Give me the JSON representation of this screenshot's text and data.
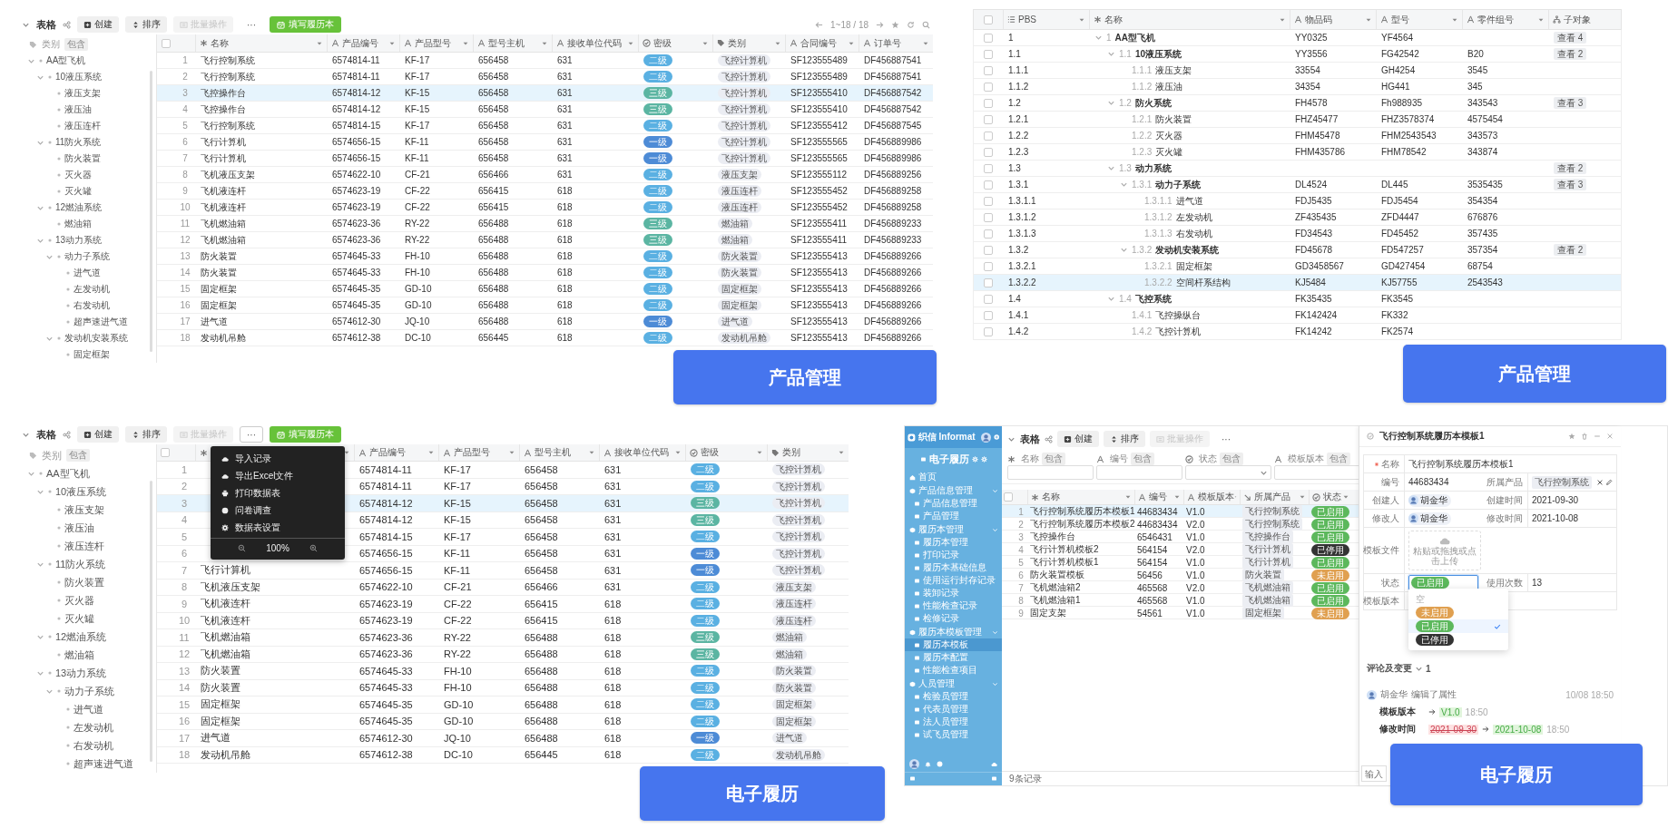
{
  "grid_view": {
    "toolbar": {
      "title": "表格",
      "buttons": [
        {
          "label": "创建",
          "kind": "create",
          "disabled": false
        },
        {
          "label": "排序",
          "kind": "sort",
          "disabled": false
        },
        {
          "label": "批量操作",
          "kind": "batch",
          "disabled": true
        }
      ],
      "more": {
        "label": "···",
        "active": false
      },
      "primary": "填写履历本"
    },
    "pager": "1~18 / 18",
    "tree": {
      "filter_label": "类别",
      "filter_op": "包含",
      "items": [
        {
          "label": "AA型飞机",
          "expanded": true,
          "children": [
            {
              "label": "10液压系统",
              "expanded": true,
              "children": [
                {
                  "label": "液压支架"
                },
                {
                  "label": "液压油"
                },
                {
                  "label": "液压连杆"
                }
              ]
            },
            {
              "label": "11防火系统",
              "expanded": true,
              "children": [
                {
                  "label": "防火装置"
                },
                {
                  "label": "灭火器"
                },
                {
                  "label": "灭火罐"
                }
              ]
            },
            {
              "label": "12燃油系统",
              "expanded": true,
              "children": [
                {
                  "label": "燃油箱"
                }
              ]
            },
            {
              "label": "13动力系统",
              "expanded": true,
              "children": [
                {
                  "label": "动力子系统",
                  "expanded": true,
                  "children": [
                    {
                      "label": "进气道"
                    },
                    {
                      "label": "左发动机"
                    },
                    {
                      "label": "右发动机"
                    },
                    {
                      "label": "超声速进气道"
                    }
                  ]
                },
                {
                  "label": "发动机安装系统",
                  "expanded": true,
                  "children": [
                    {
                      "label": "固定框架"
                    }
                  ]
                }
              ]
            }
          ]
        }
      ]
    },
    "all_checked": false,
    "columns": [
      {
        "label": "名称",
        "kind": "name"
      },
      {
        "label": "产品编号",
        "kind": "text"
      },
      {
        "label": "产品型号",
        "kind": "text"
      },
      {
        "label": "型号主机",
        "kind": "text"
      },
      {
        "label": "接收单位代码",
        "kind": "text"
      },
      {
        "label": "密级",
        "kind": "select"
      },
      {
        "label": "类别",
        "kind": "tag"
      },
      {
        "label": "合同编号",
        "kind": "text"
      },
      {
        "label": "订单号",
        "kind": "text"
      }
    ],
    "rows": [
      {
        "n": "1",
        "name": "飞行控制系统",
        "product_no": "6574814-11",
        "model": "KF-17",
        "host": "656458",
        "unit": "631",
        "secrecy": {
          "text": "二级",
          "color": "#5ab0e2"
        },
        "category": "飞控计算机",
        "contract": "SF123555489",
        "order": "DF456887541",
        "selected": false
      },
      {
        "n": "2",
        "name": "飞行控制系统",
        "product_no": "6574814-11",
        "model": "KF-17",
        "host": "656458",
        "unit": "631",
        "secrecy": {
          "text": "二级",
          "color": "#5ab0e2"
        },
        "category": "飞控计算机",
        "contract": "SF123555489",
        "order": "DF456887541",
        "selected": false
      },
      {
        "n": "3",
        "name": "飞控操作台",
        "product_no": "6574814-12",
        "model": "KF-15",
        "host": "656458",
        "unit": "631",
        "secrecy": {
          "text": "三级",
          "color": "#5bb5a2"
        },
        "category": "飞控计算机",
        "contract": "SF123555410",
        "order": "DF456887542",
        "selected": true
      },
      {
        "n": "4",
        "name": "飞控操作台",
        "product_no": "6574814-12",
        "model": "KF-15",
        "host": "656458",
        "unit": "631",
        "secrecy": {
          "text": "三级",
          "color": "#5bb5a2"
        },
        "category": "飞控计算机",
        "contract": "SF123555410",
        "order": "DF456887542",
        "selected": false
      },
      {
        "n": "5",
        "name": "飞行控制系统",
        "product_no": "6574814-15",
        "model": "KF-17",
        "host": "656458",
        "unit": "631",
        "secrecy": {
          "text": "二级",
          "color": "#5ab0e2"
        },
        "category": "飞控计算机",
        "contract": "SF123555412",
        "order": "DF456887545",
        "selected": false
      },
      {
        "n": "6",
        "name": "飞行计算机",
        "product_no": "6574656-15",
        "model": "KF-11",
        "host": "656458",
        "unit": "631",
        "secrecy": {
          "text": "一级",
          "color": "#4d8bd6"
        },
        "category": "飞控计算机",
        "contract": "SF123555565",
        "order": "DF456889986",
        "selected": false
      },
      {
        "n": "7",
        "name": "飞行计算机",
        "product_no": "6574656-15",
        "model": "KF-11",
        "host": "656458",
        "unit": "631",
        "secrecy": {
          "text": "一级",
          "color": "#4d8bd6"
        },
        "category": "飞控计算机",
        "contract": "SF123555565",
        "order": "DF456889986",
        "selected": false
      },
      {
        "n": "8",
        "name": "飞机液压支架",
        "product_no": "6574622-10",
        "model": "CF-21",
        "host": "656466",
        "unit": "631",
        "secrecy": {
          "text": "二级",
          "color": "#5ab0e2"
        },
        "category": "液压支架",
        "contract": "SF123555112",
        "order": "DF456889256",
        "selected": false
      },
      {
        "n": "9",
        "name": "飞机液连杆",
        "product_no": "6574623-19",
        "model": "CF-22",
        "host": "656415",
        "unit": "618",
        "secrecy": {
          "text": "二级",
          "color": "#5ab0e2"
        },
        "category": "液压连杆",
        "contract": "SF123555452",
        "order": "DF456889258",
        "selected": false
      },
      {
        "n": "10",
        "name": "飞机液连杆",
        "product_no": "6574623-19",
        "model": "CF-22",
        "host": "656415",
        "unit": "618",
        "secrecy": {
          "text": "二级",
          "color": "#5ab0e2"
        },
        "category": "液压连杆",
        "contract": "SF123555452",
        "order": "DF456889258",
        "selected": false
      },
      {
        "n": "11",
        "name": "飞机燃油箱",
        "product_no": "6574623-36",
        "model": "RY-22",
        "host": "656488",
        "unit": "618",
        "secrecy": {
          "text": "三级",
          "color": "#5bb5a2"
        },
        "category": "燃油箱",
        "contract": "SF123555411",
        "order": "DF456889233",
        "selected": false
      },
      {
        "n": "12",
        "name": "飞机燃油箱",
        "product_no": "6574623-36",
        "model": "RY-22",
        "host": "656488",
        "unit": "618",
        "secrecy": {
          "text": "三级",
          "color": "#5bb5a2"
        },
        "category": "燃油箱",
        "contract": "SF123555411",
        "order": "DF456889233",
        "selected": false
      },
      {
        "n": "13",
        "name": "防火装置",
        "product_no": "6574645-33",
        "model": "FH-10",
        "host": "656488",
        "unit": "618",
        "secrecy": {
          "text": "二级",
          "color": "#5ab0e2"
        },
        "category": "防火装置",
        "contract": "SF123555413",
        "order": "DF456889266",
        "selected": false
      },
      {
        "n": "14",
        "name": "防火装置",
        "product_no": "6574645-33",
        "model": "FH-10",
        "host": "656488",
        "unit": "618",
        "secrecy": {
          "text": "二级",
          "color": "#5ab0e2"
        },
        "category": "防火装置",
        "contract": "SF123555413",
        "order": "DF456889266",
        "selected": false
      },
      {
        "n": "15",
        "name": "固定框架",
        "product_no": "6574645-35",
        "model": "GD-10",
        "host": "656488",
        "unit": "618",
        "secrecy": {
          "text": "二级",
          "color": "#5ab0e2"
        },
        "category": "固定框架",
        "contract": "SF123555413",
        "order": "DF456889266",
        "selected": false
      },
      {
        "n": "16",
        "name": "固定框架",
        "product_no": "6574645-35",
        "model": "GD-10",
        "host": "656488",
        "unit": "618",
        "secrecy": {
          "text": "二级",
          "color": "#5ab0e2"
        },
        "category": "固定框架",
        "contract": "SF123555413",
        "order": "DF456889266",
        "selected": false
      },
      {
        "n": "17",
        "name": "进气道",
        "product_no": "6574612-30",
        "model": "JQ-10",
        "host": "656488",
        "unit": "618",
        "secrecy": {
          "text": "一级",
          "color": "#4d8bd6"
        },
        "category": "进气道",
        "contract": "SF123555413",
        "order": "DF456889266",
        "selected": false
      },
      {
        "n": "18",
        "name": "发动机吊舱",
        "product_no": "6574612-38",
        "model": "DC-10",
        "host": "656445",
        "unit": "618",
        "secrecy": {
          "text": "二级",
          "color": "#5ab0e2"
        },
        "category": "发动机吊舱",
        "contract": "SF123555413",
        "order": "DF456889266",
        "selected": false
      }
    ],
    "caption": "产品管理"
  },
  "pbs_view": {
    "all_checked": false,
    "columns": [
      {
        "label": "PBS",
        "kind": "list"
      },
      {
        "label": "名称",
        "kind": "name"
      },
      {
        "label": "物品码",
        "kind": "text"
      },
      {
        "label": "型号",
        "kind": "text"
      },
      {
        "label": "零件组号",
        "kind": "text"
      },
      {
        "label": "子对象",
        "kind": "tree"
      }
    ],
    "rows": [
      {
        "pbs": "1",
        "index": "1",
        "name": "AA型飞机",
        "code": "YY0325",
        "model": "YF4564",
        "sub": "查看 4",
        "expanded": true,
        "checked": false,
        "selected": false,
        "children": [
          {
            "pbs": "1.1",
            "index": "1.1",
            "name": "10液压系统",
            "code": "YY3556",
            "model": "FG42542",
            "group": "B20",
            "sub": "查看 2",
            "expanded": true,
            "checked": false,
            "selected": false,
            "children": [
              {
                "pbs": "1.1.1",
                "index": "1.1.1",
                "name": "液压支架",
                "code": "33554",
                "model": "GH4254",
                "group": "3545",
                "checked": false,
                "selected": false
              },
              {
                "pbs": "1.1.2",
                "index": "1.1.2",
                "name": "液压油",
                "code": "34354",
                "model": "HG441",
                "group": "345",
                "checked": false,
                "selected": false
              }
            ]
          },
          {
            "pbs": "1.2",
            "index": "1.2",
            "name": "防火系统",
            "code": "FH4578",
            "model": "Fh988935",
            "group": "343543",
            "sub": "查看 3",
            "expanded": true,
            "checked": false,
            "selected": false,
            "children": [
              {
                "pbs": "1.2.1",
                "index": "1.2.1",
                "name": "防火装置",
                "code": "FHZ45477",
                "model": "FHZ3578374",
                "group": "4575454",
                "checked": false,
                "selected": false
              },
              {
                "pbs": "1.2.2",
                "index": "1.2.2",
                "name": "灭火器",
                "code": "FHM45478",
                "model": "FHM2543543",
                "group": "343573",
                "checked": false,
                "selected": false
              },
              {
                "pbs": "1.2.3",
                "index": "1.2.3",
                "name": "灭火罐",
                "code": "FHM435786",
                "model": "FHM78542",
                "group": "343874",
                "checked": false,
                "selected": false
              }
            ]
          },
          {
            "pbs": "1.3",
            "index": "1.3",
            "name": "动力系统",
            "sub": "查看 2",
            "expanded": true,
            "checked": false,
            "selected": false,
            "children": [
              {
                "pbs": "1.3.1",
                "index": "1.3.1",
                "name": "动力子系统",
                "code": "DL4524",
                "model": "DL445",
                "group": "3535435",
                "sub": "查看 3",
                "expanded": true,
                "checked": false,
                "selected": false,
                "children": [
                  {
                    "pbs": "1.3.1.1",
                    "index": "1.3.1.1",
                    "name": "进气道",
                    "code": "FDJ5435",
                    "model": "FDJ5454",
                    "group": "354354",
                    "checked": false,
                    "selected": false
                  },
                  {
                    "pbs": "1.3.1.2",
                    "index": "1.3.1.2",
                    "name": "左发动机",
                    "code": "ZF435435",
                    "model": "ZFD4447",
                    "group": "676876",
                    "checked": false,
                    "selected": false
                  },
                  {
                    "pbs": "1.3.1.3",
                    "index": "1.3.1.3",
                    "name": "右发动机",
                    "code": "FD34543",
                    "model": "FD45452",
                    "group": "357435",
                    "checked": false,
                    "selected": false
                  }
                ]
              },
              {
                "pbs": "1.3.2",
                "index": "1.3.2",
                "name": "发动机安装系统",
                "code": "FD45678",
                "model": "FD547257",
                "group": "357354",
                "sub": "查看 2",
                "expanded": true,
                "checked": false,
                "selected": false,
                "children": [
                  {
                    "pbs": "1.3.2.1",
                    "index": "1.3.2.1",
                    "name": "固定框架",
                    "code": "GD3458567",
                    "model": "GD427454",
                    "group": "68754",
                    "checked": false,
                    "selected": false
                  },
                  {
                    "pbs": "1.3.2.2",
                    "index": "1.3.2.2",
                    "name": "空间杆系结构",
                    "code": "KJ5484",
                    "model": "KJ57755",
                    "group": "2543543",
                    "checked": false,
                    "selected": true
                  }
                ]
              }
            ]
          },
          {
            "pbs": "1.4",
            "index": "1.4",
            "name": "飞控系统",
            "code": "FK35435",
            "model": "FK3545",
            "expanded": true,
            "checked": false,
            "selected": false,
            "children": [
              {
                "pbs": "1.4.1",
                "index": "1.4.1",
                "name": "飞控操纵台",
                "code": "FK142424",
                "model": "FK332",
                "checked": false,
                "selected": false
              },
              {
                "pbs": "1.4.2",
                "index": "1.4.2",
                "name": "飞控计算机",
                "code": "FK14242",
                "model": "FK2574",
                "checked": false,
                "selected": false
              }
            ]
          }
        ]
      }
    ],
    "caption": "产品管理"
  },
  "grid_view_menu": {
    "toolbar": {
      "title": "表格",
      "buttons": [
        {
          "label": "创建",
          "kind": "create",
          "disabled": false
        },
        {
          "label": "排序",
          "kind": "sort",
          "disabled": false
        },
        {
          "label": "批量操作",
          "kind": "batch",
          "disabled": true
        }
      ],
      "more": {
        "label": "···",
        "active": true
      },
      "primary": "填写履历本"
    },
    "tree": {
      "filter_label": "类别",
      "filter_op": "包含",
      "items": [
        {
          "label": "AA型飞机",
          "expanded": true,
          "children": [
            {
              "label": "10液压系统",
              "expanded": true,
              "children": [
                {
                  "label": "液压支架"
                },
                {
                  "label": "液压油"
                },
                {
                  "label": "液压连杆"
                }
              ]
            },
            {
              "label": "11防火系统",
              "expanded": true,
              "children": [
                {
                  "label": "防火装置"
                },
                {
                  "label": "灭火器"
                },
                {
                  "label": "灭火罐"
                }
              ]
            },
            {
              "label": "12燃油系统",
              "expanded": true,
              "children": [
                {
                  "label": "燃油箱"
                }
              ]
            },
            {
              "label": "13动力系统",
              "expanded": true,
              "children": [
                {
                  "label": "动力子系统",
                  "expanded": true,
                  "children": [
                    {
                      "label": "进气道"
                    },
                    {
                      "label": "左发动机"
                    },
                    {
                      "label": "右发动机"
                    },
                    {
                      "label": "超声速进气道"
                    }
                  ]
                }
              ]
            }
          ]
        }
      ]
    },
    "all_checked": false,
    "columns": [
      {
        "kind": "name"
      },
      {
        "label": "产品编号",
        "kind": "text"
      },
      {
        "label": "产品型号",
        "kind": "text"
      },
      {
        "label": "型号主机",
        "kind": "text"
      },
      {
        "label": "接收单位代码",
        "kind": "text"
      },
      {
        "label": "密级",
        "kind": "select"
      },
      {
        "label": "类别",
        "kind": "tag"
      }
    ],
    "rows": [
      {
        "n": "1",
        "product_no": "6574814-11",
        "model": "KF-17",
        "host": "656458",
        "unit": "631",
        "secrecy": {
          "text": "二级",
          "color": "#5ab0e2"
        },
        "category": "飞控计算机",
        "selected": false
      },
      {
        "n": "2",
        "product_no": "6574814-11",
        "model": "KF-17",
        "host": "656458",
        "unit": "631",
        "secrecy": {
          "text": "二级",
          "color": "#5ab0e2"
        },
        "category": "飞控计算机",
        "selected": false
      },
      {
        "n": "3",
        "product_no": "6574814-12",
        "model": "KF-15",
        "host": "656458",
        "unit": "631",
        "secrecy": {
          "text": "三级",
          "color": "#5bb5a2"
        },
        "category": "飞控计算机",
        "selected": true
      },
      {
        "n": "4",
        "product_no": "6574814-12",
        "model": "KF-15",
        "host": "656458",
        "unit": "631",
        "secrecy": {
          "text": "三级",
          "color": "#5bb5a2"
        },
        "category": "飞控计算机",
        "selected": false
      },
      {
        "n": "5",
        "product_no": "6574814-15",
        "model": "KF-17",
        "host": "656458",
        "unit": "631",
        "secrecy": {
          "text": "二级",
          "color": "#5ab0e2"
        },
        "category": "飞控计算机",
        "selected": false
      },
      {
        "n": "6",
        "product_no": "6574656-15",
        "model": "KF-11",
        "host": "656458",
        "unit": "631",
        "secrecy": {
          "text": "一级",
          "color": "#4d8bd6"
        },
        "category": "飞控计算机",
        "selected": false
      },
      {
        "n": "7",
        "name": "飞行计算机",
        "product_no": "6574656-15",
        "model": "KF-11",
        "host": "656458",
        "unit": "631",
        "secrecy": {
          "text": "一级",
          "color": "#4d8bd6"
        },
        "category": "飞控计算机",
        "selected": false
      },
      {
        "n": "8",
        "name": "飞机液压支架",
        "product_no": "6574622-10",
        "model": "CF-21",
        "host": "656466",
        "unit": "631",
        "secrecy": {
          "text": "二级",
          "color": "#5ab0e2"
        },
        "category": "液压支架",
        "selected": false
      },
      {
        "n": "9",
        "name": "飞机液连杆",
        "product_no": "6574623-19",
        "model": "CF-22",
        "host": "656415",
        "unit": "618",
        "secrecy": {
          "text": "二级",
          "color": "#5ab0e2"
        },
        "category": "液压连杆",
        "selected": false
      },
      {
        "n": "10",
        "name": "飞机液连杆",
        "product_no": "6574623-19",
        "model": "CF-22",
        "host": "656415",
        "unit": "618",
        "secrecy": {
          "text": "二级",
          "color": "#5ab0e2"
        },
        "category": "液压连杆",
        "selected": false
      },
      {
        "n": "11",
        "name": "飞机燃油箱",
        "product_no": "6574623-36",
        "model": "RY-22",
        "host": "656488",
        "unit": "618",
        "secrecy": {
          "text": "三级",
          "color": "#5bb5a2"
        },
        "category": "燃油箱",
        "selected": false
      },
      {
        "n": "12",
        "name": "飞机燃油箱",
        "product_no": "6574623-36",
        "model": "RY-22",
        "host": "656488",
        "unit": "618",
        "secrecy": {
          "text": "三级",
          "color": "#5bb5a2"
        },
        "category": "燃油箱",
        "selected": false
      },
      {
        "n": "13",
        "name": "防火装置",
        "product_no": "6574645-33",
        "model": "FH-10",
        "host": "656488",
        "unit": "618",
        "secrecy": {
          "text": "二级",
          "color": "#5ab0e2"
        },
        "category": "防火装置",
        "selected": false
      },
      {
        "n": "14",
        "name": "防火装置",
        "product_no": "6574645-33",
        "model": "FH-10",
        "host": "656488",
        "unit": "618",
        "secrecy": {
          "text": "二级",
          "color": "#5ab0e2"
        },
        "category": "防火装置",
        "selected": false
      },
      {
        "n": "15",
        "name": "固定框架",
        "product_no": "6574645-35",
        "model": "GD-10",
        "host": "656488",
        "unit": "618",
        "secrecy": {
          "text": "二级",
          "color": "#5ab0e2"
        },
        "category": "固定框架",
        "selected": false
      },
      {
        "n": "16",
        "name": "固定框架",
        "product_no": "6574645-35",
        "model": "GD-10",
        "host": "656488",
        "unit": "618",
        "secrecy": {
          "text": "二级",
          "color": "#5ab0e2"
        },
        "category": "固定框架",
        "selected": false
      },
      {
        "n": "17",
        "name": "进气道",
        "product_no": "6574612-30",
        "model": "JQ-10",
        "host": "656488",
        "unit": "618",
        "secrecy": {
          "text": "一级",
          "color": "#4d8bd6"
        },
        "category": "进气道",
        "selected": false
      },
      {
        "n": "18",
        "name": "发动机吊舱",
        "product_no": "6574612-38",
        "model": "DC-10",
        "host": "656445",
        "unit": "618",
        "secrecy": {
          "text": "二级",
          "color": "#5ab0e2"
        },
        "category": "发动机吊舱",
        "selected": false
      }
    ],
    "menu": [
      {
        "label": "导入记录",
        "kind": "import"
      },
      {
        "label": "导出Excel文件",
        "kind": "export"
      },
      {
        "label": "打印数据表",
        "kind": "print"
      },
      {
        "label": "问卷调查",
        "kind": "survey"
      },
      {
        "label": "数据表设置",
        "kind": "settings"
      }
    ],
    "zoom": "100%",
    "caption": "电子履历"
  },
  "record_app": {
    "brand": "织信 Informat",
    "app_title": "电子履历",
    "menu": [
      {
        "label": "首页",
        "kind": "link",
        "selected": false
      },
      {
        "label": "产品信息管理",
        "kind": "group",
        "expanded": true,
        "children": [
          {
            "label": "产品信息管理",
            "selected": false
          },
          {
            "label": "产品管理",
            "selected": false
          }
        ]
      },
      {
        "label": "履历本管理",
        "kind": "group",
        "expanded": true,
        "children": [
          {
            "label": "履历本管理",
            "selected": false
          },
          {
            "label": "打印记录",
            "selected": false
          },
          {
            "label": "履历本基础信息",
            "selected": false
          },
          {
            "label": "使用运行封存记录",
            "selected": false
          },
          {
            "label": "装卸记录",
            "selected": false
          },
          {
            "label": "性能检查记录",
            "selected": false
          },
          {
            "label": "检修记录",
            "selected": false
          }
        ]
      },
      {
        "label": "履历本模板管理",
        "kind": "group",
        "expanded": true,
        "children": [
          {
            "label": "履历本模板",
            "selected": true
          },
          {
            "label": "履历本配置",
            "selected": false
          },
          {
            "label": "性能检查项目",
            "selected": false
          }
        ]
      },
      {
        "label": "人员管理",
        "kind": "group",
        "expanded": true,
        "children": [
          {
            "label": "检验员管理",
            "selected": false
          },
          {
            "label": "代表员管理",
            "selected": false
          },
          {
            "label": "法人员管理",
            "selected": false
          },
          {
            "label": "试飞员管理",
            "selected": false
          }
        ]
      }
    ],
    "toolbar": {
      "title": "表格",
      "buttons": [
        {
          "label": "创建",
          "kind": "create",
          "disabled": false
        },
        {
          "label": "排序",
          "kind": "sort",
          "disabled": false
        },
        {
          "label": "批量操作",
          "kind": "batch",
          "disabled": true
        }
      ],
      "more": {
        "label": "···",
        "active": false
      }
    },
    "filters": [
      {
        "label": "名称",
        "op": "包含",
        "kind": "name"
      },
      {
        "label": "编号",
        "op": "包含",
        "kind": "text"
      },
      {
        "label": "状态",
        "op": "包含",
        "kind": "select"
      },
      {
        "label": "模板版本",
        "op": "包含",
        "kind": "text"
      }
    ],
    "all_checked": false,
    "columns": [
      {
        "label": "名称",
        "kind": "name"
      },
      {
        "label": "编号",
        "kind": "text"
      },
      {
        "label": "模板版本",
        "kind": "text"
      },
      {
        "label": "所属产品",
        "kind": "relation"
      },
      {
        "label": "状态",
        "kind": "select"
      }
    ],
    "rows": [
      {
        "n": "1",
        "name": "飞行控制系统履历本模板1",
        "code": "44683434",
        "version": "V1.0",
        "product": "飞行控制系统",
        "status": {
          "text": "已启用",
          "color": "#5cb85c"
        },
        "selected": true
      },
      {
        "n": "2",
        "name": "飞行控制系统履历本模板2",
        "code": "44683434",
        "version": "V2.0",
        "product": "飞行控制系统",
        "status": {
          "text": "已启用",
          "color": "#5cb85c"
        },
        "selected": false
      },
      {
        "n": "3",
        "name": "飞控操作台",
        "code": "6546431",
        "version": "V1.0",
        "product": "飞控操作台",
        "status": {
          "text": "已启用",
          "color": "#5cb85c"
        },
        "selected": false
      },
      {
        "n": "4",
        "name": "飞行计算机模板2",
        "code": "564154",
        "version": "V2.0",
        "product": "飞行计算机",
        "status": {
          "text": "已停用",
          "color": "#333333"
        },
        "selected": false
      },
      {
        "n": "5",
        "name": "飞行计算机模板1",
        "code": "564154",
        "version": "V1.0",
        "product": "飞行计算机",
        "status": {
          "text": "已启用",
          "color": "#5cb85c"
        },
        "selected": false
      },
      {
        "n": "6",
        "name": "防火装置模板",
        "code": "56456",
        "version": "V1.0",
        "product": "防火装置",
        "status": {
          "text": "未启用",
          "color": "#e0a050"
        },
        "selected": false
      },
      {
        "n": "7",
        "name": "飞机燃油箱2",
        "code": "465568",
        "version": "V2.0",
        "product": "飞机燃油箱",
        "status": {
          "text": "已启用",
          "color": "#5cb85c"
        },
        "selected": false
      },
      {
        "n": "8",
        "name": "飞机燃油箱1",
        "code": "465568",
        "version": "V1.0",
        "product": "飞机燃油箱",
        "status": {
          "text": "已启用",
          "color": "#5cb85c"
        },
        "selected": false
      },
      {
        "n": "9",
        "name": "固定支架",
        "code": "54561",
        "version": "V1.0",
        "product": "固定框架",
        "status": {
          "text": "未启用",
          "color": "#e0a050"
        },
        "selected": false
      }
    ],
    "footer": "9条记录",
    "detail": {
      "title": "飞行控制系统履历本模板1",
      "form": [
        [
          {
            "label": "名称",
            "required": true,
            "kind": "text",
            "value": "飞行控制系统履历本模板1"
          }
        ],
        [
          {
            "label": "编号",
            "kind": "text",
            "value": "44683434"
          },
          {
            "label": "所属产品",
            "kind": "relation",
            "value": "飞行控制系统"
          }
        ],
        [
          {
            "label": "创建人",
            "kind": "user",
            "value": "胡金华"
          },
          {
            "label": "创建时间",
            "kind": "text",
            "value": "2021-09-30"
          }
        ],
        [
          {
            "label": "修改人",
            "kind": "user",
            "value": "胡金华"
          },
          {
            "label": "修改时间",
            "kind": "text",
            "value": "2021-10-08"
          }
        ],
        [
          {
            "label": "模板文件",
            "kind": "upload",
            "value": "粘贴或拖拽或点击上传"
          }
        ],
        [
          {
            "label": "状态",
            "kind": "status",
            "value": "已启用",
            "color": "#5cb85c",
            "focused": true
          },
          {
            "label": "使用次数",
            "kind": "text",
            "value": "13"
          }
        ],
        [
          {
            "label": "模板版本",
            "kind": "text"
          }
        ]
      ],
      "status_options": [
        {
          "label": "空",
          "kind": "empty",
          "selected": false
        },
        {
          "label": "未启用",
          "kind": "badge",
          "color": "#e0a050",
          "selected": false
        },
        {
          "label": "已启用",
          "kind": "badge",
          "color": "#5cb85c",
          "selected": true
        },
        {
          "label": "已停用",
          "kind": "badge",
          "color": "#333333",
          "selected": false
        }
      ],
      "comments": {
        "title": "评论及变更",
        "count": "1",
        "entries": [
          {
            "user": "胡金华",
            "action": "编辑了属性",
            "time": "10/08 18:50",
            "changes": [
              {
                "field": "模板版本",
                "new": "V1.0",
                "time": "18:50"
              },
              {
                "field": "修改时间",
                "old": "2021-09-30",
                "new": "2021-10-08",
                "time": "18:50"
              }
            ]
          }
        ]
      },
      "input_placeholder": "输入"
    },
    "caption": "电子履历"
  }
}
